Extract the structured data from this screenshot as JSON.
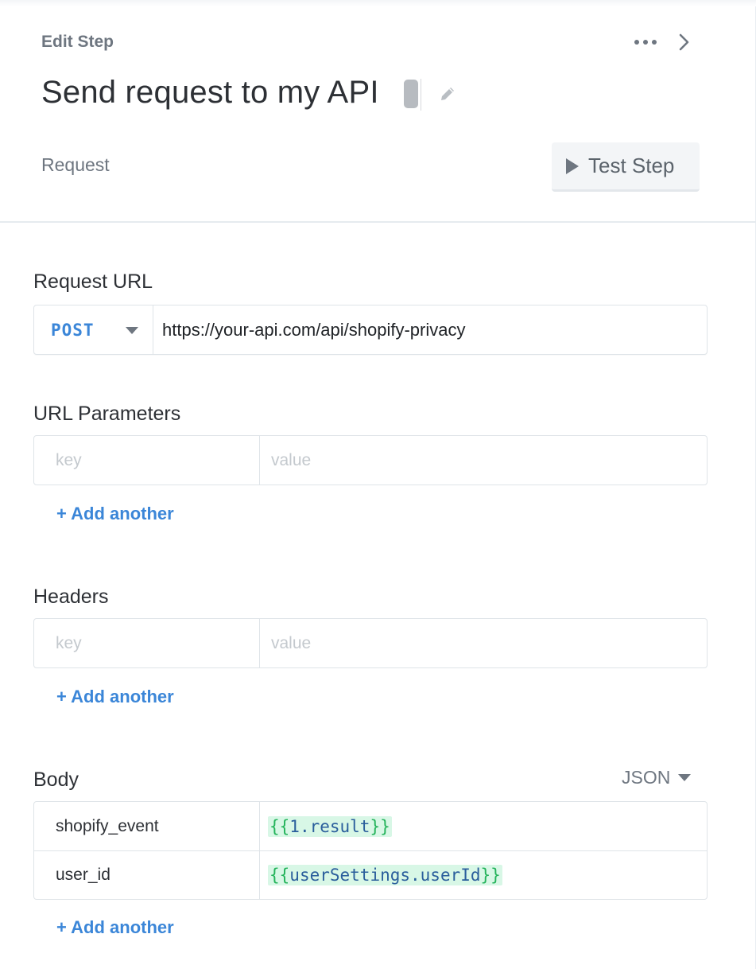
{
  "header": {
    "edit_step_label": "Edit Step",
    "step_title": "Send request to my API",
    "request_tab": "Request",
    "test_step_label": "Test Step"
  },
  "request_url": {
    "section_label": "Request URL",
    "method": "POST",
    "url": "https://your-api.com/api/shopify-privacy"
  },
  "url_parameters": {
    "section_label": "URL Parameters",
    "key_placeholder": "key",
    "value_placeholder": "value",
    "add_label": "+ Add another"
  },
  "headers": {
    "section_label": "Headers",
    "key_placeholder": "key",
    "value_placeholder": "value",
    "add_label": "+ Add another"
  },
  "body": {
    "section_label": "Body",
    "format": "JSON",
    "rows": [
      {
        "key": "shopify_event",
        "value_expr": "1.result"
      },
      {
        "key": "user_id",
        "value_expr": "userSettings.userId"
      }
    ],
    "add_label": "+ Add another"
  },
  "icons": [
    "more-icon",
    "chevron-right-icon",
    "pencil-icon",
    "play-icon",
    "dropdown-caret-icon"
  ],
  "colors": {
    "accent": "#3b86d8",
    "token_bg": "#d8f7e6",
    "token_brace": "#23b35a"
  }
}
